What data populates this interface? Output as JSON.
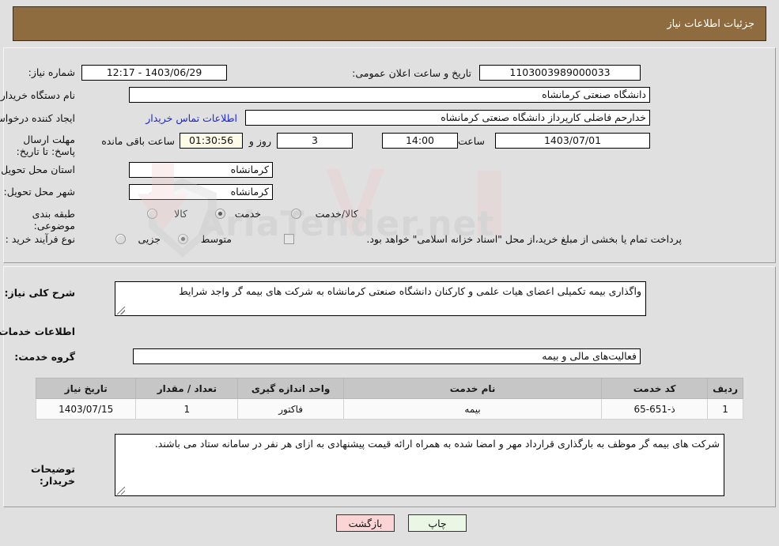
{
  "header": {
    "title": "جزئیات اطلاعات نیاز"
  },
  "top_form": {
    "need_number_label": "شماره نیاز:",
    "need_number_value": "1103003989000033",
    "announce_datetime_label": "تاریخ و ساعت اعلان عمومی:",
    "announce_datetime_value": "1403/06/29 - 12:17",
    "buyer_org_label": "نام دستگاه خریدار:",
    "buyer_org_value": "دانشگاه صنعتی کرمانشاه",
    "requester_label": "ایجاد کننده درخواست:",
    "requester_value": "خدارحم فاضلی کارپرداز دانشگاه صنعتی کرمانشاه",
    "buyer_contact_link": "اطلاعات تماس خریدار",
    "deadline_label": "مهلت ارسال پاسخ: تا تاریخ:",
    "deadline_date": "1403/07/01",
    "hour_label": "ساعت",
    "hour_value": "14:00",
    "days_value": "3",
    "days_label": "روز و",
    "countdown_value": "01:30:56",
    "countdown_label": "ساعت باقی مانده",
    "province_label": "استان محل تحویل:",
    "province_value": "کرمانشاه",
    "city_label": "شهر محل تحویل:",
    "city_value": "کرمانشاه",
    "category_label": "طبقه بندی موضوعی:",
    "category_options": [
      {
        "label": "کالا",
        "selected": false
      },
      {
        "label": "خدمت",
        "selected": true
      },
      {
        "label": "کالا/خدمت",
        "selected": false
      }
    ],
    "process_type_label": "نوع فرآیند خرید :",
    "process_type_options": [
      {
        "label": "جزیی",
        "selected": false
      },
      {
        "label": "متوسط",
        "selected": true
      }
    ],
    "treasury_checkbox_label": "پرداخت تمام یا بخشی از مبلغ خرید،از محل \"اسناد خزانه اسلامی\" خواهد بود.",
    "treasury_checked": false
  },
  "bottom_form": {
    "need_description_label": "شرح کلی نیاز:",
    "need_description_value": "واگذاری بیمه تکمیلی اعضای هیات علمی و کارکنان دانشگاه صنعتی کرمانشاه به شرکت های بیمه گر واجد شرایط",
    "services_section_title": "اطلاعات خدمات مورد نیاز",
    "service_group_label": "گروه خدمت:",
    "service_group_value": "فعالیت‌های مالی و بیمه",
    "table": {
      "columns": [
        "ردیف",
        "کد خدمت",
        "نام خدمت",
        "واحد اندازه گیری",
        "تعداد / مقدار",
        "تاریخ نیاز"
      ],
      "rows": [
        {
          "row": "1",
          "service_code": "ذ-651-65",
          "service_name": "بیمه",
          "unit": "فاکتور",
          "quantity": "1",
          "need_date": "1403/07/15"
        }
      ]
    },
    "buyer_notes_label": "توضیحات خریدار:",
    "buyer_notes_value": "شرکت های بیمه گر موظف به بارگذاری قرارداد مهر و امضا شده به همراه ارائه قیمت پیشنهادی به ازای هر نفر در سامانه ستاد می باشند."
  },
  "footer": {
    "back_button": "بازگشت",
    "print_button": "چاپ"
  },
  "watermark": {
    "text": "AriaTender.net"
  },
  "colors": {
    "header_bg": "#8e6c40",
    "page_bg": "#e0e0e0",
    "link": "#1a27d8",
    "back_button_bg": "#fbd5d5",
    "print_button_bg": "#e9f7e4",
    "countdown_bg": "#fbfbe8"
  }
}
